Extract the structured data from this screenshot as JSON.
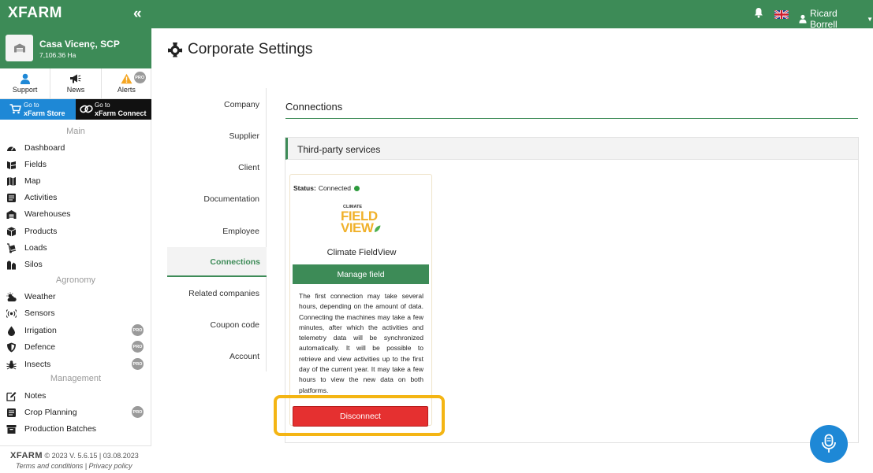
{
  "topbar": {
    "logo": "XFARM",
    "collapse_glyph": "«",
    "user_name": "Ricard Borrell",
    "bell_icon": "bell-icon",
    "language_flag": "uk-flag-icon"
  },
  "farm": {
    "name": "Casa Vicenç, SCP",
    "area": "7,106.36 Ha"
  },
  "quick_actions": {
    "support": "Support",
    "news": "News",
    "alerts": "Alerts",
    "pro": "PRO"
  },
  "promos": {
    "store_small": "Go to",
    "store_big": "xFarm Store",
    "connect_small": "Go to",
    "connect_big": "xFarm Connect"
  },
  "sidebar": {
    "section_main": "Main",
    "section_agronomy": "Agronomy",
    "section_management": "Management",
    "items": {
      "dashboard": "Dashboard",
      "fields": "Fields",
      "map": "Map",
      "activities": "Activities",
      "warehouses": "Warehouses",
      "products": "Products",
      "loads": "Loads",
      "silos": "Silos",
      "weather": "Weather",
      "sensors": "Sensors",
      "irrigation": "Irrigation",
      "defence": "Defence",
      "insects": "Insects",
      "notes": "Notes",
      "crop_planning": "Crop Planning",
      "production_batches": "Production Batches"
    },
    "pro": "PRO",
    "footer_logo": "XFARM",
    "footer_version": "© 2023 V. 5.6.15 | 03.08.2023",
    "footer_links": "Terms and conditions | Privacy policy"
  },
  "page": {
    "title": "Corporate Settings"
  },
  "tabs": {
    "company": "Company",
    "supplier": "Supplier",
    "client": "Client",
    "documentation": "Documentation",
    "employee": "Employee",
    "connections": "Connections",
    "related_companies": "Related companies",
    "coupon_code": "Coupon code",
    "account": "Account"
  },
  "connections": {
    "title": "Connections",
    "panel_title": "Third-party services",
    "card": {
      "status_label": "Status:",
      "status_value": "Connected",
      "status_color": "#2d9a3c",
      "logo_climate": "CLIMATE",
      "logo_field": "FIELD",
      "logo_view": "VIEW",
      "name": "Climate FieldView",
      "manage_label": "Manage field",
      "description": "The first connection may take several hours, depending on the amount of data. Connecting the machines may take a few minutes, after which the activities and telemetry data will be synchronized automatically. It will be possible to retrieve and view activities up to the first day of the current year. It may take a few hours to view the new data on both platforms.",
      "disconnect_label": "Disconnect"
    }
  },
  "colors": {
    "brand_green": "#3d8b57",
    "store_blue": "#1e88d6",
    "disconnect_red": "#e53030",
    "highlight_yellow": "#f4b514"
  }
}
